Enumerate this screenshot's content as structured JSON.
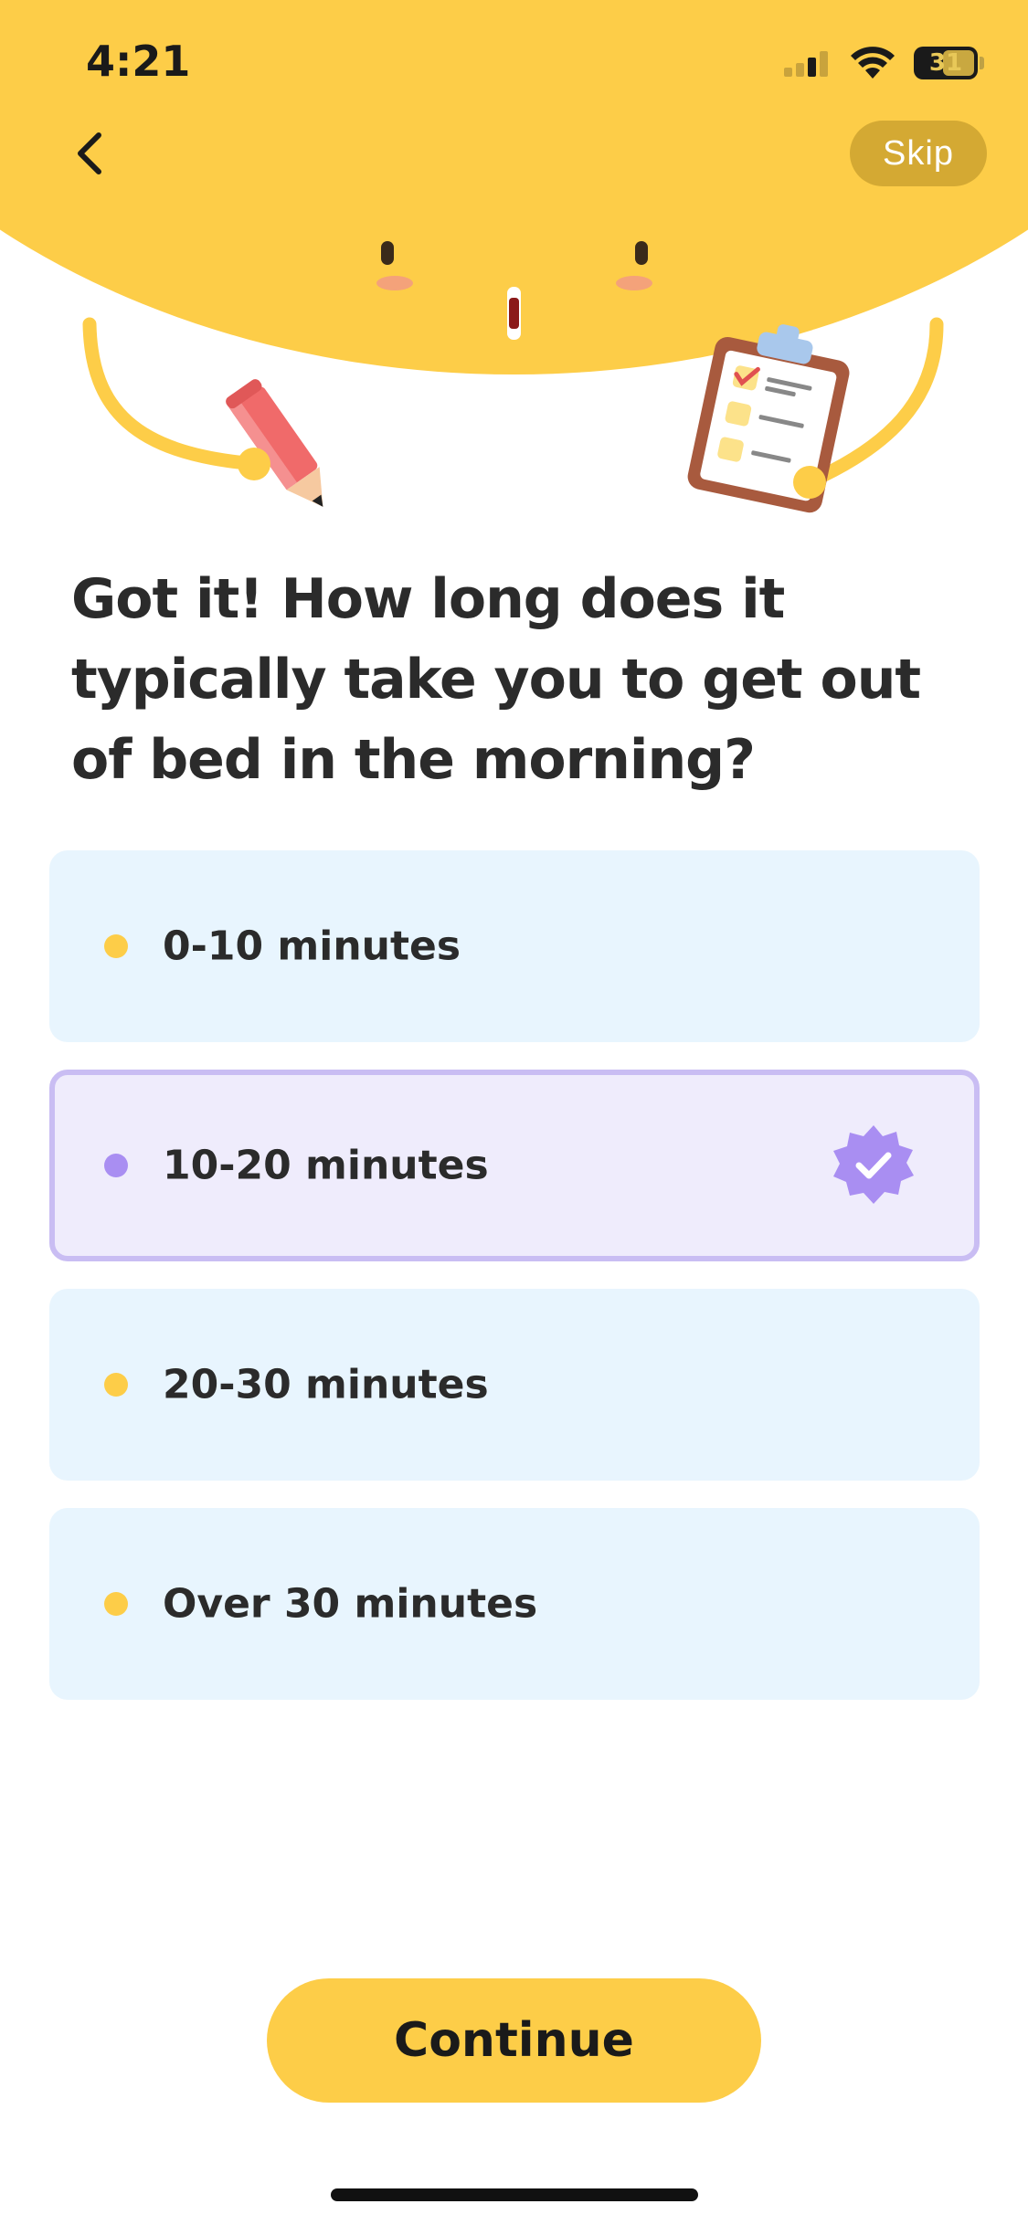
{
  "status_bar": {
    "time": "4:21",
    "battery_percent": "31"
  },
  "header": {
    "back_icon": "chevron-left-icon",
    "skip_label": "Skip"
  },
  "colors": {
    "accent_yellow": "#FDCD48",
    "option_bg": "#E8F5FE",
    "selected_bg": "#EFECFC",
    "selected_border": "#C9BDF3",
    "selected_dot": "#A98EF2"
  },
  "question": "Got it! How long does it typically take you to get out of bed in the morning?",
  "options": [
    {
      "label": "0-10 minutes",
      "selected": false
    },
    {
      "label": "10-20 minutes",
      "selected": true
    },
    {
      "label": "20-30 minutes",
      "selected": false
    },
    {
      "label": "Over 30 minutes",
      "selected": false
    }
  ],
  "footer": {
    "continue_label": "Continue"
  }
}
